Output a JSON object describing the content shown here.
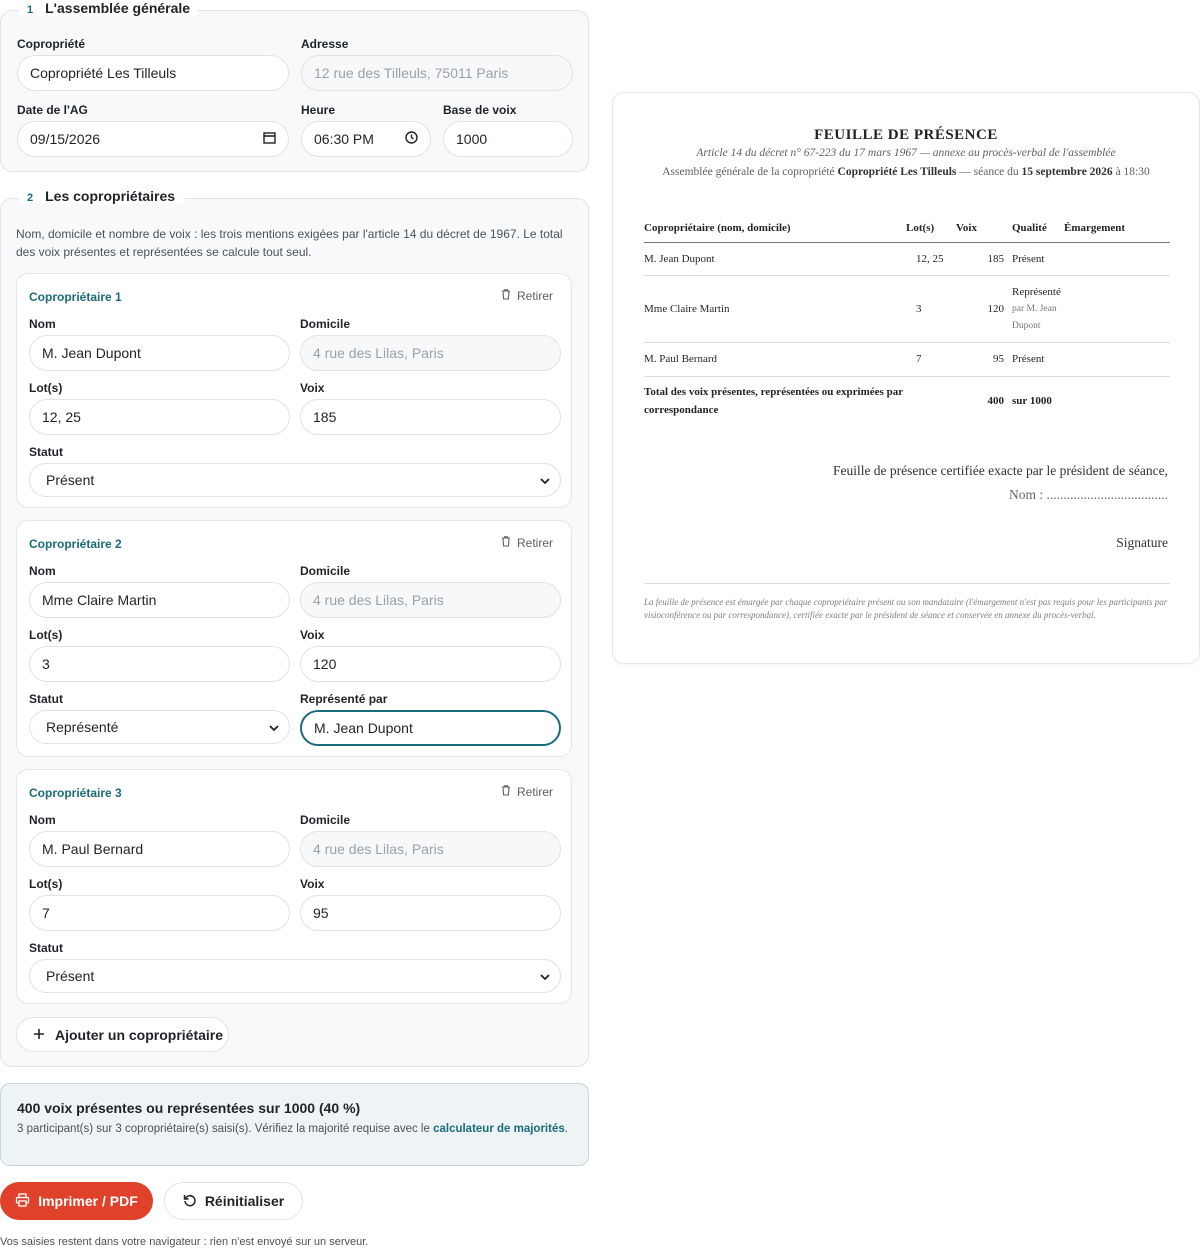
{
  "sections": {
    "ag_num": "1",
    "ag_title": "L'assemblée générale",
    "owners_num": "2",
    "owners_title": "Les copropriétaires"
  },
  "ag": {
    "copro_label": "Copropriété",
    "copro_value": "Copropriété Les Tilleuls",
    "address_label": "Adresse",
    "address_placeholder": "12 rue des Tilleuls, 75011 Paris",
    "date_label": "Date de l'AG",
    "date_value": "09/15/2026",
    "time_label": "Heure",
    "time_value": "06:30 PM",
    "base_label": "Base de voix",
    "base_value": "1000"
  },
  "help": "Nom, domicile et nombre de voix : les trois mentions exigées par l'article 14 du décret de 1967. Le total des voix présentes et représentées se calcule tout seul.",
  "owners": [
    {
      "title": "Copropriétaire 1",
      "remove": "Retirer",
      "name_label": "Nom",
      "name": "M. Jean Dupont",
      "home_label": "Domicile",
      "home_placeholder": "4 rue des Lilas, Paris",
      "lots_label": "Lot(s)",
      "lots": "12, 25",
      "votes_label": "Voix",
      "votes": "185",
      "status_label": "Statut",
      "status": "Présent"
    },
    {
      "title": "Copropriétaire 2",
      "remove": "Retirer",
      "name_label": "Nom",
      "name": "Mme Claire Martin",
      "home_label": "Domicile",
      "home_placeholder": "4 rue des Lilas, Paris",
      "lots_label": "Lot(s)",
      "lots": "3",
      "votes_label": "Voix",
      "votes": "120",
      "status_label": "Statut",
      "status": "Représenté",
      "proxy_label": "Représenté par",
      "proxy": "M. Jean Dupont"
    },
    {
      "title": "Copropriétaire 3",
      "remove": "Retirer",
      "name_label": "Nom",
      "name": "M. Paul Bernard",
      "home_label": "Domicile",
      "home_placeholder": "4 rue des Lilas, Paris",
      "lots_label": "Lot(s)",
      "lots": "7",
      "votes_label": "Voix",
      "votes": "95",
      "status_label": "Statut",
      "status": "Présent"
    }
  ],
  "add_owner": "Ajouter un copropriétaire",
  "summary": {
    "title": "400 voix présentes ou représentées sur 1000 (40 %)",
    "text": "3 participant(s) sur 3 copropriétaire(s) saisi(s). Vérifiez la majorité requise avec le ",
    "link": "calculateur de majorités",
    "end": "."
  },
  "buttons": {
    "print": "Imprimer / PDF",
    "reset": "Réinitialiser"
  },
  "footer": "Vos saisies restent dans votre navigateur : rien n'est envoyé sur un serveur.",
  "doc": {
    "title": "FEUILLE DE PRÉSENCE",
    "subtitle": "Article 14 du décret n° 67-223 du 17 mars 1967 — annexe au procès-verbal de l'assemblée",
    "line_a": "Assemblée générale de la copropriété ",
    "copro": "Copropriété Les Tilleuls",
    "line_b": " — séance du ",
    "date": "15 septembre 2026",
    "line_c": " à 18:30",
    "headers": [
      "Copropriétaire (nom, domicile)",
      "Lot(s)",
      "Voix",
      "Qualité",
      "Émargement"
    ],
    "rows": [
      {
        "name": "M. Jean Dupont",
        "lots": "12, 25",
        "votes": "185",
        "quality": "Présent",
        "by": ""
      },
      {
        "name": "Mme Claire Martin",
        "lots": "3",
        "votes": "120",
        "quality": "Représenté",
        "by": "par M. Jean Dupont"
      },
      {
        "name": "M. Paul Bernard",
        "lots": "7",
        "votes": "95",
        "quality": "Présent",
        "by": ""
      }
    ],
    "total_label": "Total des voix présentes, représentées ou exprimées par correspondance",
    "total": "400",
    "total_of": "sur 1000",
    "cert": "Feuille de présence certifiée exacte par le président de séance,",
    "cert_name": "Nom : ....................................",
    "signature": "Signature",
    "note": "La feuille de présence est émargée par chaque copropriétaire présent ou son mandataire (l'émargement n'est pas requis pour les participants par visioconférence ou par correspondance), certifiée exacte par le président de séance et conservée en annexe du procès-verbal."
  }
}
